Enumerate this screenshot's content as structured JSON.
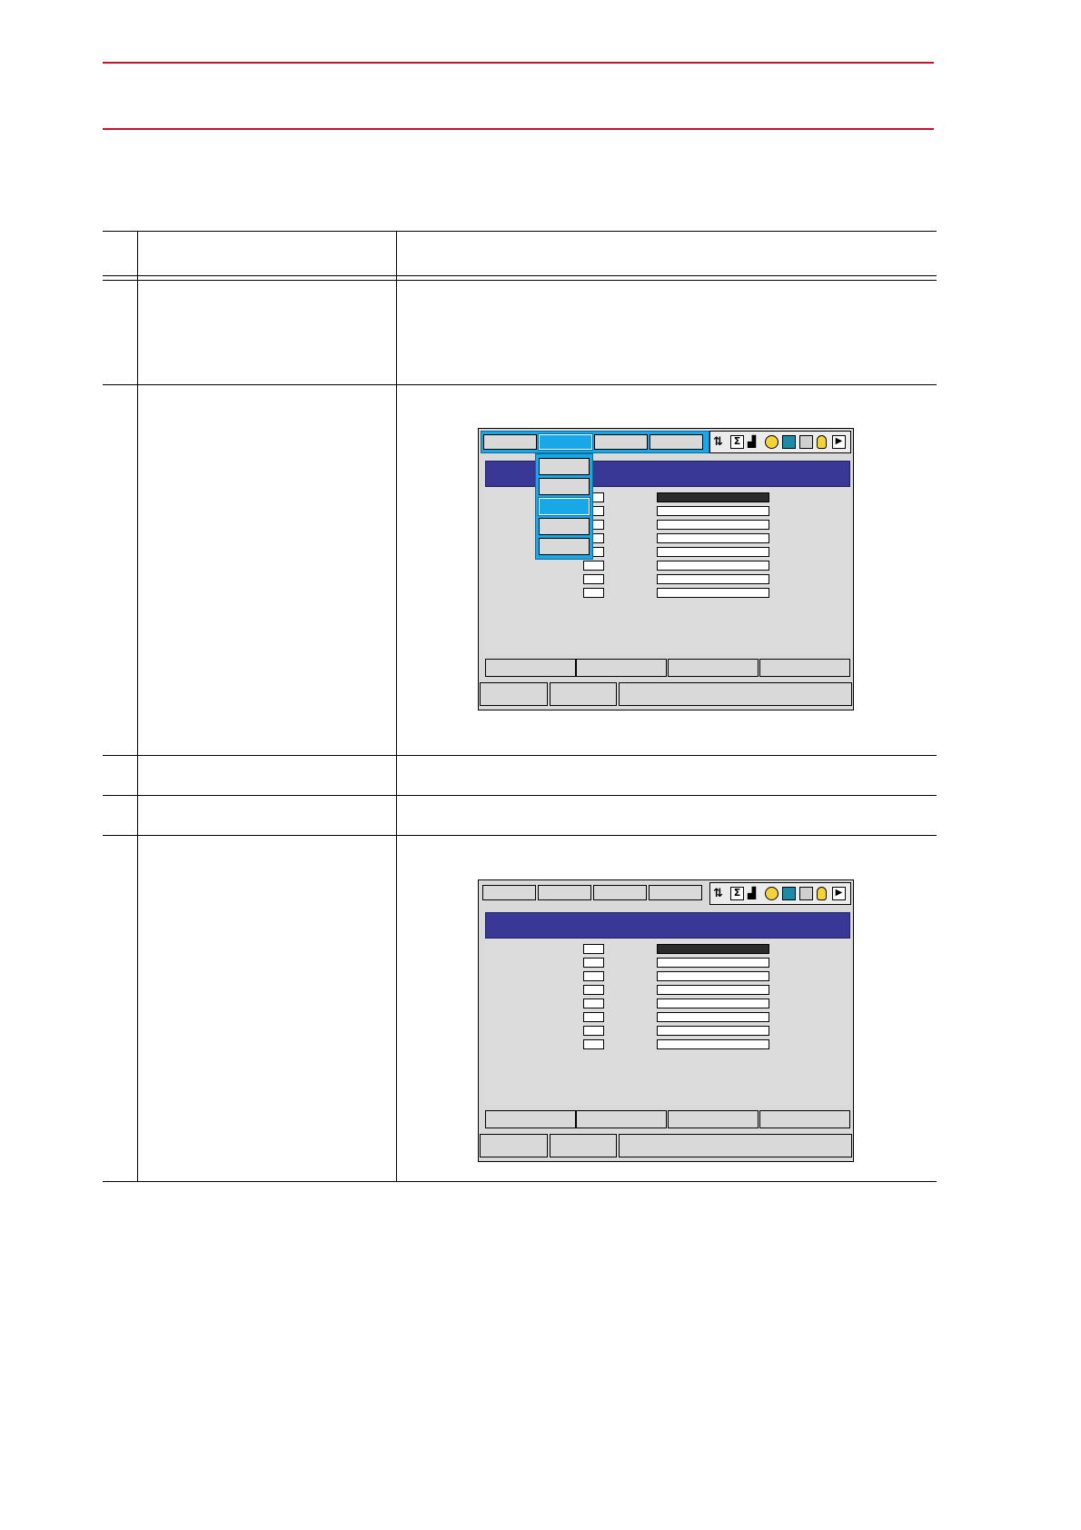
{
  "document": {
    "step_table": {
      "rows": 6
    }
  },
  "screen_1": {
    "menu_tabs": [
      "",
      "",
      "",
      ""
    ],
    "selected_menu_index": 1,
    "dropdown_items": [
      "",
      "",
      "",
      "",
      ""
    ],
    "selected_dropdown_index": 2,
    "highlighted_field_index": 0,
    "icons": [
      "multitask-icon",
      "sigma-icon",
      "signal-icon",
      "gear-icon",
      "storage-icon",
      "page-icon",
      "hand-icon",
      "play-icon"
    ]
  },
  "screen_2": {
    "menu_tabs": [
      "",
      "",
      "",
      ""
    ],
    "highlighted_field_index": 0,
    "icons": [
      "multitask-icon",
      "sigma-icon",
      "signal-icon",
      "gear-icon",
      "storage-icon",
      "page-icon",
      "hand-icon",
      "play-icon"
    ]
  },
  "colors": {
    "rule": "#c8102e",
    "title_bar": "#3a3896",
    "selection": "#1aa7e8",
    "panel": "#d9d9d9"
  }
}
